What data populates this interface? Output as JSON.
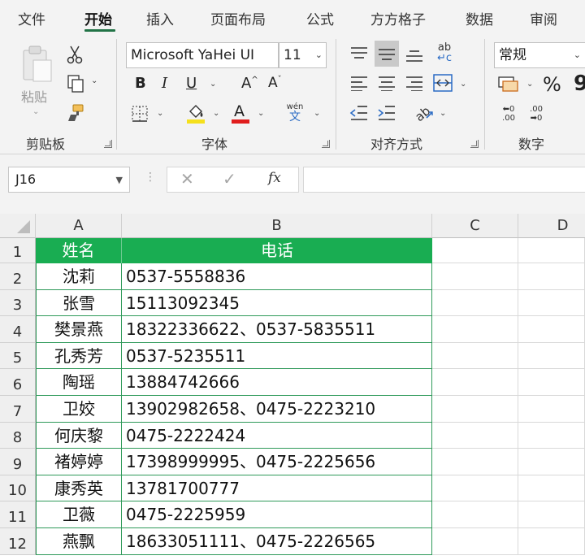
{
  "menu": {
    "tabs": [
      "文件",
      "开始",
      "插入",
      "页面布局",
      "公式",
      "方方格子",
      "数据",
      "审阅"
    ],
    "active": "开始"
  },
  "ribbon": {
    "clipboard": {
      "paste_label": "粘贴",
      "group_label": "剪贴板"
    },
    "font": {
      "font_name": "Microsoft YaHei UI",
      "font_size": "11",
      "group_label": "字体",
      "bold": "B",
      "italic": "I",
      "underline": "U",
      "grow": "A",
      "shrink": "A",
      "font_color_glyph": "A",
      "phonetic": "wén\n文"
    },
    "alignment": {
      "group_label": "对齐方式",
      "wrap_glyph": "ab\nc"
    },
    "number": {
      "format": "常规",
      "group_label": "数字",
      "percent": "%",
      "comma": "9"
    }
  },
  "formula_bar": {
    "name_box": "J16",
    "fx": "fx",
    "formula": ""
  },
  "sheet": {
    "columns": [
      "A",
      "B",
      "C",
      "D"
    ],
    "header_row": {
      "name": "姓名",
      "phone": "电话"
    },
    "rows": [
      {
        "num": "2",
        "name": "沈莉",
        "phone": "0537-5558836"
      },
      {
        "num": "3",
        "name": "张雪",
        "phone": "15113092345"
      },
      {
        "num": "4",
        "name": "樊景燕",
        "phone": "18322336622、0537-5835511"
      },
      {
        "num": "5",
        "name": "孔秀芳",
        "phone": "0537-5235511"
      },
      {
        "num": "6",
        "name": "陶瑶",
        "phone": "13884742666"
      },
      {
        "num": "7",
        "name": "卫姣",
        "phone": "13902982658、0475-2223210"
      },
      {
        "num": "8",
        "name": "何庆黎",
        "phone": "0475-2222424"
      },
      {
        "num": "9",
        "name": "褚婷婷",
        "phone": "17398999995、0475-2225656"
      },
      {
        "num": "10",
        "name": "康秀英",
        "phone": "13781700777"
      },
      {
        "num": "11",
        "name": "卫薇",
        "phone": "0475-2225959"
      },
      {
        "num": "12",
        "name": "燕飘",
        "phone": "18633051111、0475-2226565"
      }
    ],
    "header_row_num": "1",
    "accent": "#19ad52",
    "tab_accent": "#217346"
  }
}
